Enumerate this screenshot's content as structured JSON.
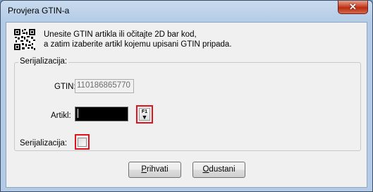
{
  "window": {
    "title": "Provjera GTIN-a",
    "close_glyph": "✕"
  },
  "instructions": {
    "line1": "Unesite GTIN artikla ili očitajte 2D bar kod,",
    "line2": "a zatim izaberite artikl kojemu upisani GTIN pripada."
  },
  "group": {
    "label": "Serijalizacija:",
    "gtin_label": "GTIN:",
    "gtin_value": "110186865770",
    "artikl_label": "Artikl:",
    "artikl_value": "",
    "lookup_key": "F1",
    "lookup_arrow": "▼",
    "serialization_label": "Serijalizacija:",
    "serialization_checked": false
  },
  "buttons": {
    "accept_mnemonic": "P",
    "accept_rest": "rihvati",
    "cancel_mnemonic": "O",
    "cancel_rest": "dustani"
  },
  "colors": {
    "highlight": "#e0141e",
    "artikl_field_bg": "#000000"
  }
}
